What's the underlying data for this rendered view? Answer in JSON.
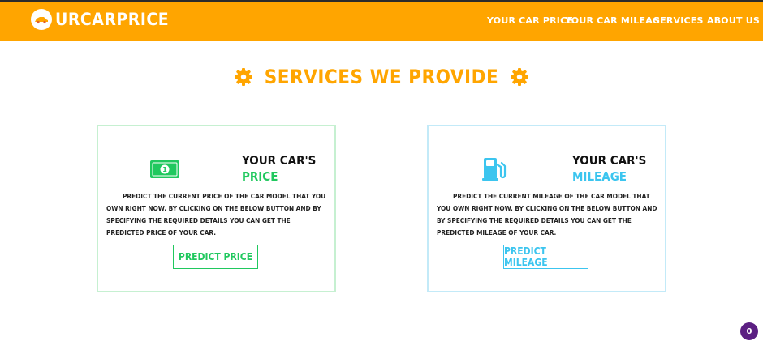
{
  "nav": {
    "brand": "Urcarprice",
    "links": [
      "Your Car Price",
      "Your Car Mileage",
      "Services",
      "About Us"
    ]
  },
  "section": {
    "heading": "Services We Provide"
  },
  "cards": [
    {
      "title_line1": "Your Car's",
      "title_line2": "Price",
      "description": "Predict the current price of the car model that you own right now. By clicking on the below button and by specifying the required details you can get the predicted price of your car.",
      "button": "Predict Price",
      "icon": "money-icon"
    },
    {
      "title_line1": "Your Car's",
      "title_line2": "Mileage",
      "description": "Predict the current mileage of the car model that you own right now. By clicking on the below button and by specifying the required details you can get the predicted mileage of your car.",
      "button": "Predict Mileage",
      "icon": "fuel-pump-icon"
    }
  ],
  "badge": {
    "count": "0"
  },
  "colors": {
    "brand_orange": "#ffa500",
    "price_green": "#20c85e",
    "mileage_blue": "#3cc5ef",
    "badge_purple": "#5b1f82"
  }
}
